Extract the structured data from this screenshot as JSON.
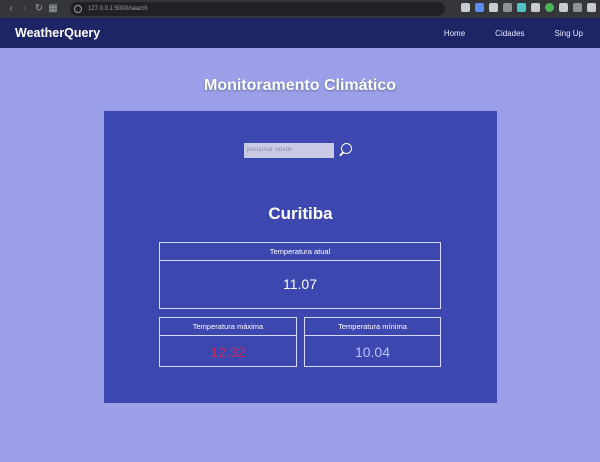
{
  "browser": {
    "url": "127.0.0.1:5000/search"
  },
  "navbar": {
    "brand": "WeatherQuery",
    "links": [
      "Home",
      "Cidades",
      "Sing Up"
    ]
  },
  "page": {
    "title": "Monitoramento Climático"
  },
  "search": {
    "placeholder": "pesquisar cidade"
  },
  "weather": {
    "city": "Curitiba",
    "current": {
      "label": "Temperatura atual",
      "value": "11.07"
    },
    "max": {
      "label": "Temperatura máxima",
      "value": "12.32"
    },
    "min": {
      "label": "Temperatura mínima",
      "value": "10.04"
    }
  },
  "colors": {
    "navbar": "#1e2566",
    "background": "#9a9fe8",
    "card": "#3d47b0",
    "max_value": "#c12d63",
    "min_value": "#b9c4ff"
  }
}
